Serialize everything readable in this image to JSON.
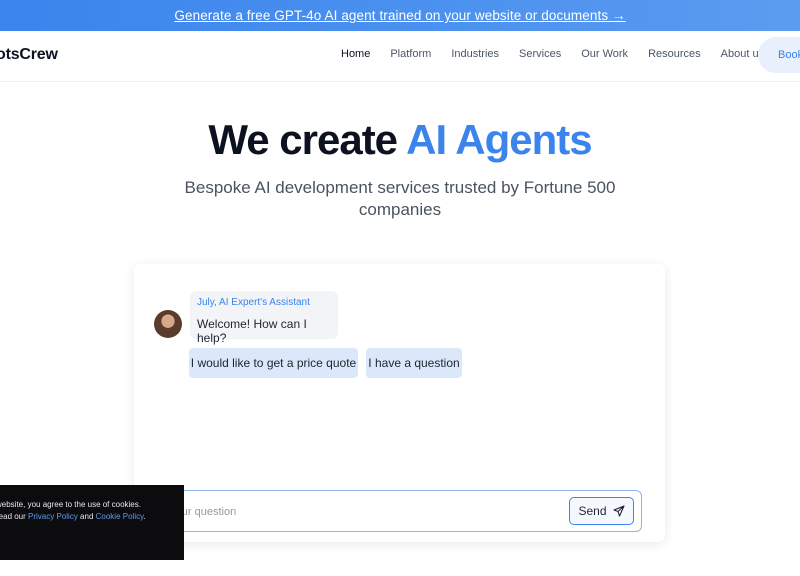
{
  "banner": {
    "text": "Generate a free GPT-4o AI agent trained on your website or documents →"
  },
  "nav": {
    "logo": "otsCrew",
    "items": [
      "Home",
      "Platform",
      "Industries",
      "Services",
      "Our Work",
      "Resources",
      "About us"
    ],
    "active": "Home",
    "cta": "Book"
  },
  "hero": {
    "title_part1": "We create ",
    "title_accent": "AI Agents",
    "subtitle": "Bespoke AI development services trusted by Fortune 500 companies"
  },
  "chat": {
    "agent_name": "July, AI Expert's Assistant",
    "welcome": "Welcome! How can I help?",
    "quick_replies": [
      "I would like to get a price quote",
      "I have a question"
    ],
    "input_placeholder": "e your question",
    "send_label": "Send"
  },
  "cookie": {
    "line1": "website, you agree to the use of cookies.",
    "line2_prefix": "read our ",
    "privacy_link": "Privacy Policy",
    "and": " and ",
    "cookie_link": "Cookie Policy",
    "suffix": "."
  },
  "colors": {
    "accent": "#3a84ec",
    "banner": "#4d92ef",
    "text": "#0c1220"
  }
}
